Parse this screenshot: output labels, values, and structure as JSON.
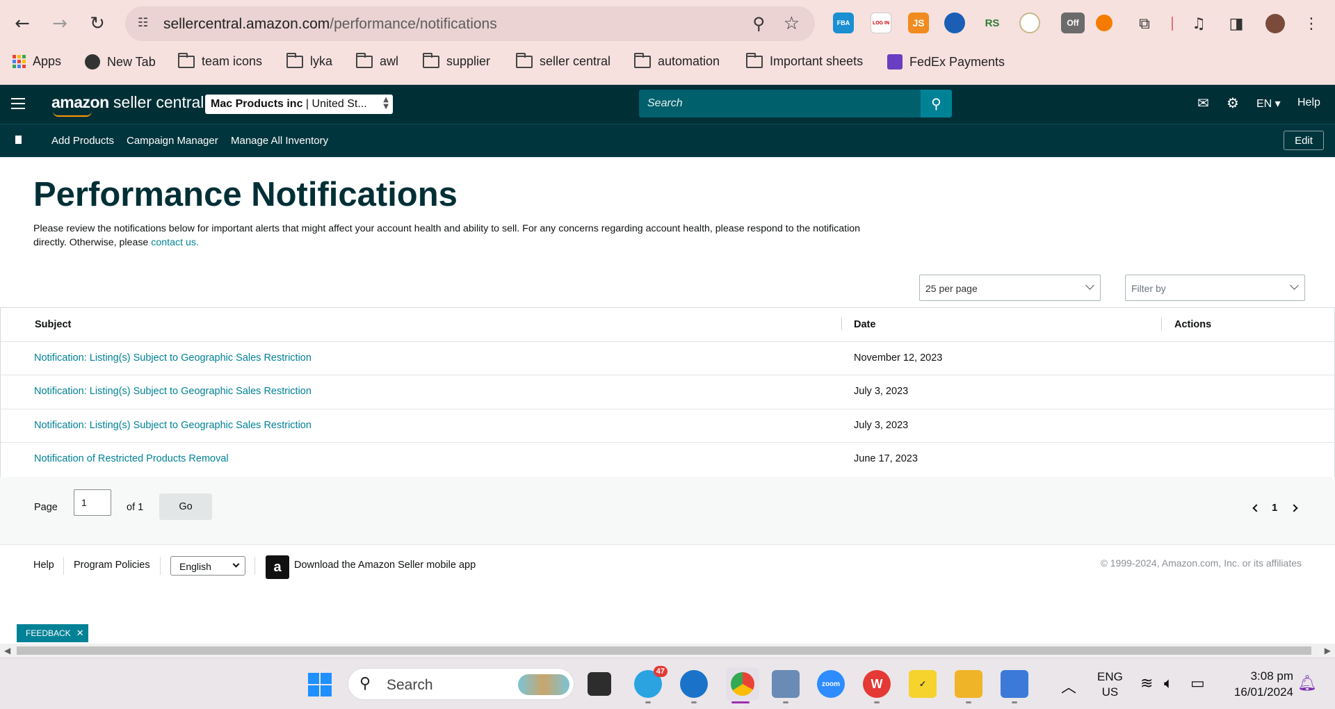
{
  "browser": {
    "url_domain": "sellercentral.amazon.com",
    "url_path": "/performance/notifications",
    "bookmarks": [
      {
        "label": "Apps",
        "icon": "apps-grid-icon"
      },
      {
        "label": "New Tab",
        "icon": "globe-icon"
      },
      {
        "label": "team icons",
        "icon": "folder-icon"
      },
      {
        "label": "lyka",
        "icon": "folder-icon"
      },
      {
        "label": "awl",
        "icon": "folder-icon"
      },
      {
        "label": "supplier",
        "icon": "folder-icon"
      },
      {
        "label": "seller central",
        "icon": "folder-icon"
      },
      {
        "label": "automation",
        "icon": "folder-icon"
      },
      {
        "label": "Important sheets",
        "icon": "folder-icon"
      },
      {
        "label": "FedEx Payments",
        "icon": "fedex-icon"
      }
    ],
    "extensions": [
      {
        "name": "FBA",
        "color": "#1a8fd1"
      },
      {
        "name": "LOG IN",
        "color": "#ffffff"
      },
      {
        "name": "JS",
        "color": "#f28b1f"
      },
      {
        "name": "RS",
        "color": "#2e7d32"
      }
    ],
    "ext_badge": "Off"
  },
  "header": {
    "brand_bold": "amazon",
    "brand_rest": " seller central",
    "account_bold": "Mac Products inc",
    "account_rest": " | United St...",
    "search_placeholder": "Search",
    "language": "EN",
    "help": "Help"
  },
  "subnav": {
    "links": [
      "Add Products",
      "Campaign Manager",
      "Manage All Inventory"
    ],
    "edit": "Edit"
  },
  "page": {
    "title": "Performance Notifications",
    "intro_text": "Please review the notifications below for important alerts that might affect your account health and ability to sell. For any concerns regarding account health, please respond to the notification directly. Otherwise, please ",
    "intro_link": "contact us."
  },
  "controls": {
    "per_page": "25 per page",
    "filter_placeholder": "Filter by"
  },
  "table": {
    "columns": [
      "Subject",
      "Date",
      "Actions"
    ],
    "rows": [
      {
        "subject": "Notification: Listing(s) Subject to Geographic Sales Restriction",
        "date": "November 12, 2023"
      },
      {
        "subject": "Notification: Listing(s) Subject to Geographic Sales Restriction",
        "date": "July 3, 2023"
      },
      {
        "subject": "Notification: Listing(s) Subject to Geographic Sales Restriction",
        "date": "July 3, 2023"
      },
      {
        "subject": "Notification of Restricted Products Removal",
        "date": "June 17, 2023"
      }
    ]
  },
  "pagination": {
    "page_label": "Page",
    "page_value": "1",
    "of_label": "of 1",
    "go": "Go",
    "current": "1"
  },
  "footer": {
    "help": "Help",
    "program_policies": "Program Policies",
    "language": "English",
    "app_text": "Download the Amazon Seller mobile app",
    "copyright": "© 1999-2024, Amazon.com, Inc. or its affiliates"
  },
  "feedback": "FEEDBACK",
  "taskbar": {
    "search_label": "Search",
    "telegram_badge": "47",
    "zoom_label": "zoom",
    "lang_line1": "ENG",
    "lang_line2": "US",
    "time": "3:08 pm",
    "date": "16/01/2024"
  }
}
